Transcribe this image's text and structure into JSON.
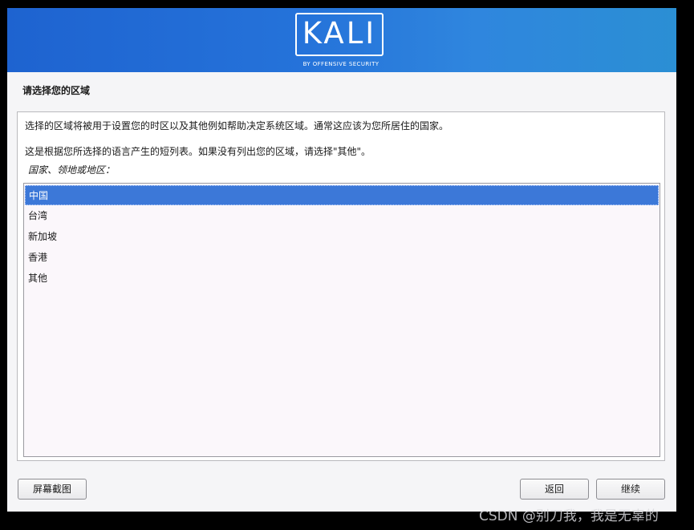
{
  "banner": {
    "logo_text": "KALI",
    "logo_subtitle": "BY OFFENSIVE SECURITY"
  },
  "page_title": "请选择您的区域",
  "description": {
    "line1": "选择的区域将被用于设置您的时区以及其他例如帮助决定系统区域。通常这应该为您所居住的国家。",
    "line2": "这是根据您所选择的语言产生的短列表。如果没有列出您的区域，请选择\"其他\"。"
  },
  "list": {
    "label": "国家、领地或地区：",
    "selected_index": 0,
    "items": [
      {
        "label": "中国"
      },
      {
        "label": "台湾"
      },
      {
        "label": "新加坡"
      },
      {
        "label": "香港"
      },
      {
        "label": "其他"
      }
    ]
  },
  "buttons": {
    "screenshot": "屏幕截图",
    "back": "返回",
    "continue": "继续"
  },
  "watermark": "CSDN @别刀我，我是无辜的",
  "colors": {
    "banner_start": "#1e63d0",
    "banner_end": "#2b8fd4",
    "selection": "#3c78d8"
  }
}
